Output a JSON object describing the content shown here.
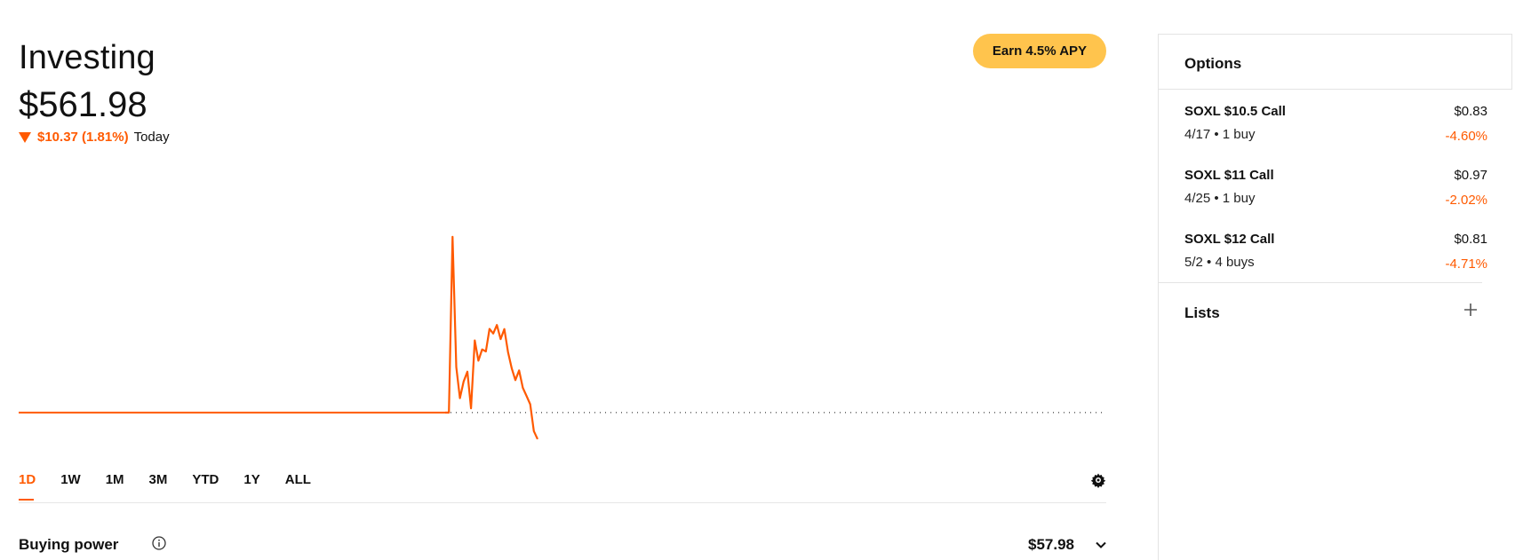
{
  "header": {
    "title": "Investing",
    "value": "$561.98",
    "change": "$10.37 (1.81%)",
    "period": "Today",
    "earn_label": "Earn 4.5% APY"
  },
  "ranges": [
    "1D",
    "1W",
    "1M",
    "3M",
    "YTD",
    "1Y",
    "ALL"
  ],
  "active_range": "1D",
  "buying_power": {
    "label": "Buying power",
    "value": "$57.98"
  },
  "options": {
    "title": "Options",
    "items": [
      {
        "name": "SOXL $10.5 Call",
        "sub": "4/17 • 1 buy",
        "price": "$0.83",
        "pct": "-4.60%"
      },
      {
        "name": "SOXL $11 Call",
        "sub": "4/25 • 1 buy",
        "price": "$0.97",
        "pct": "-2.02%"
      },
      {
        "name": "SOXL $12 Call",
        "sub": "5/2 • 4 buys",
        "price": "$0.81",
        "pct": "-4.71%"
      }
    ]
  },
  "lists": {
    "title": "Lists"
  },
  "icons": [
    "down-triangle-icon",
    "gear-icon",
    "info-icon",
    "chevron-down-icon",
    "plus-icon"
  ],
  "colors": {
    "accent": "#ff5a00",
    "earn_bg": "#ffc44d"
  },
  "chart_data": {
    "type": "line",
    "baseline": 572.35,
    "x": [
      0,
      1,
      2,
      3,
      4,
      5,
      6,
      7,
      8,
      9,
      10,
      11,
      12,
      13,
      14,
      15,
      16,
      17,
      18,
      19,
      20,
      21,
      22,
      23,
      24,
      25,
      26,
      27,
      28,
      29,
      30,
      31,
      32,
      33,
      34,
      35,
      36,
      37,
      38,
      39,
      40,
      41,
      42,
      43,
      44,
      45,
      46,
      47,
      48,
      49,
      50
    ],
    "values": [
      572.35,
      572.35,
      572.35,
      572.35,
      572.35,
      572.35,
      572.35,
      572.35,
      572.35,
      572.35,
      572.35,
      572.35,
      572.35,
      572.35,
      572.35,
      572.35,
      572.35,
      572.35,
      572.35,
      572.35,
      572.35,
      572.35,
      572.35,
      572.35,
      572.35,
      572.35,
      572.35,
      572.35,
      572.35,
      572.35,
      572.35,
      572.35,
      572.35,
      572.35,
      572.35,
      572.35,
      572.35,
      572.35,
      572.35,
      572.35,
      572.35,
      572.35,
      572.35,
      572.35,
      572.35,
      572.35,
      572.35,
      572.35,
      572.35,
      572.35,
      572.35
    ],
    "intraday": [
      572.35,
      572.35,
      640.9,
      590.1,
      578.0,
      584.5,
      588.3,
      574.0,
      600.5,
      592.6,
      597.0,
      596.2,
      605.0,
      603.2,
      606.5,
      601.0,
      604.9,
      596.0,
      589.6,
      585.0,
      588.8,
      582.0,
      578.9,
      575.6,
      565.1,
      561.98
    ]
  }
}
